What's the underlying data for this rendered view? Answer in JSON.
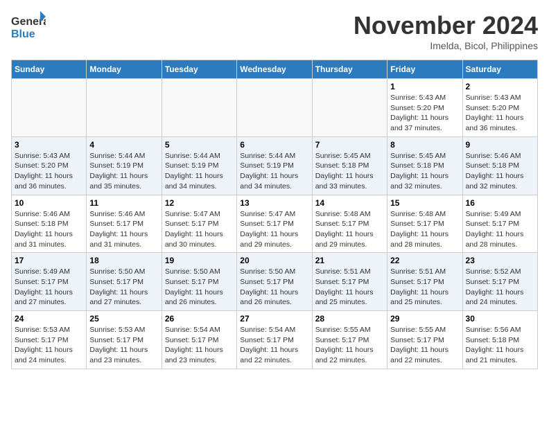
{
  "header": {
    "logo_general": "General",
    "logo_blue": "Blue",
    "month": "November 2024",
    "location": "Imelda, Bicol, Philippines"
  },
  "weekdays": [
    "Sunday",
    "Monday",
    "Tuesday",
    "Wednesday",
    "Thursday",
    "Friday",
    "Saturday"
  ],
  "weeks": [
    [
      {
        "day": "",
        "info": ""
      },
      {
        "day": "",
        "info": ""
      },
      {
        "day": "",
        "info": ""
      },
      {
        "day": "",
        "info": ""
      },
      {
        "day": "",
        "info": ""
      },
      {
        "day": "1",
        "info": "Sunrise: 5:43 AM\nSunset: 5:20 PM\nDaylight: 11 hours\nand 37 minutes."
      },
      {
        "day": "2",
        "info": "Sunrise: 5:43 AM\nSunset: 5:20 PM\nDaylight: 11 hours\nand 36 minutes."
      }
    ],
    [
      {
        "day": "3",
        "info": "Sunrise: 5:43 AM\nSunset: 5:20 PM\nDaylight: 11 hours\nand 36 minutes."
      },
      {
        "day": "4",
        "info": "Sunrise: 5:44 AM\nSunset: 5:19 PM\nDaylight: 11 hours\nand 35 minutes."
      },
      {
        "day": "5",
        "info": "Sunrise: 5:44 AM\nSunset: 5:19 PM\nDaylight: 11 hours\nand 34 minutes."
      },
      {
        "day": "6",
        "info": "Sunrise: 5:44 AM\nSunset: 5:19 PM\nDaylight: 11 hours\nand 34 minutes."
      },
      {
        "day": "7",
        "info": "Sunrise: 5:45 AM\nSunset: 5:18 PM\nDaylight: 11 hours\nand 33 minutes."
      },
      {
        "day": "8",
        "info": "Sunrise: 5:45 AM\nSunset: 5:18 PM\nDaylight: 11 hours\nand 32 minutes."
      },
      {
        "day": "9",
        "info": "Sunrise: 5:46 AM\nSunset: 5:18 PM\nDaylight: 11 hours\nand 32 minutes."
      }
    ],
    [
      {
        "day": "10",
        "info": "Sunrise: 5:46 AM\nSunset: 5:18 PM\nDaylight: 11 hours\nand 31 minutes."
      },
      {
        "day": "11",
        "info": "Sunrise: 5:46 AM\nSunset: 5:17 PM\nDaylight: 11 hours\nand 31 minutes."
      },
      {
        "day": "12",
        "info": "Sunrise: 5:47 AM\nSunset: 5:17 PM\nDaylight: 11 hours\nand 30 minutes."
      },
      {
        "day": "13",
        "info": "Sunrise: 5:47 AM\nSunset: 5:17 PM\nDaylight: 11 hours\nand 29 minutes."
      },
      {
        "day": "14",
        "info": "Sunrise: 5:48 AM\nSunset: 5:17 PM\nDaylight: 11 hours\nand 29 minutes."
      },
      {
        "day": "15",
        "info": "Sunrise: 5:48 AM\nSunset: 5:17 PM\nDaylight: 11 hours\nand 28 minutes."
      },
      {
        "day": "16",
        "info": "Sunrise: 5:49 AM\nSunset: 5:17 PM\nDaylight: 11 hours\nand 28 minutes."
      }
    ],
    [
      {
        "day": "17",
        "info": "Sunrise: 5:49 AM\nSunset: 5:17 PM\nDaylight: 11 hours\nand 27 minutes."
      },
      {
        "day": "18",
        "info": "Sunrise: 5:50 AM\nSunset: 5:17 PM\nDaylight: 11 hours\nand 27 minutes."
      },
      {
        "day": "19",
        "info": "Sunrise: 5:50 AM\nSunset: 5:17 PM\nDaylight: 11 hours\nand 26 minutes."
      },
      {
        "day": "20",
        "info": "Sunrise: 5:50 AM\nSunset: 5:17 PM\nDaylight: 11 hours\nand 26 minutes."
      },
      {
        "day": "21",
        "info": "Sunrise: 5:51 AM\nSunset: 5:17 PM\nDaylight: 11 hours\nand 25 minutes."
      },
      {
        "day": "22",
        "info": "Sunrise: 5:51 AM\nSunset: 5:17 PM\nDaylight: 11 hours\nand 25 minutes."
      },
      {
        "day": "23",
        "info": "Sunrise: 5:52 AM\nSunset: 5:17 PM\nDaylight: 11 hours\nand 24 minutes."
      }
    ],
    [
      {
        "day": "24",
        "info": "Sunrise: 5:53 AM\nSunset: 5:17 PM\nDaylight: 11 hours\nand 24 minutes."
      },
      {
        "day": "25",
        "info": "Sunrise: 5:53 AM\nSunset: 5:17 PM\nDaylight: 11 hours\nand 23 minutes."
      },
      {
        "day": "26",
        "info": "Sunrise: 5:54 AM\nSunset: 5:17 PM\nDaylight: 11 hours\nand 23 minutes."
      },
      {
        "day": "27",
        "info": "Sunrise: 5:54 AM\nSunset: 5:17 PM\nDaylight: 11 hours\nand 22 minutes."
      },
      {
        "day": "28",
        "info": "Sunrise: 5:55 AM\nSunset: 5:17 PM\nDaylight: 11 hours\nand 22 minutes."
      },
      {
        "day": "29",
        "info": "Sunrise: 5:55 AM\nSunset: 5:17 PM\nDaylight: 11 hours\nand 22 minutes."
      },
      {
        "day": "30",
        "info": "Sunrise: 5:56 AM\nSunset: 5:18 PM\nDaylight: 11 hours\nand 21 minutes."
      }
    ]
  ]
}
